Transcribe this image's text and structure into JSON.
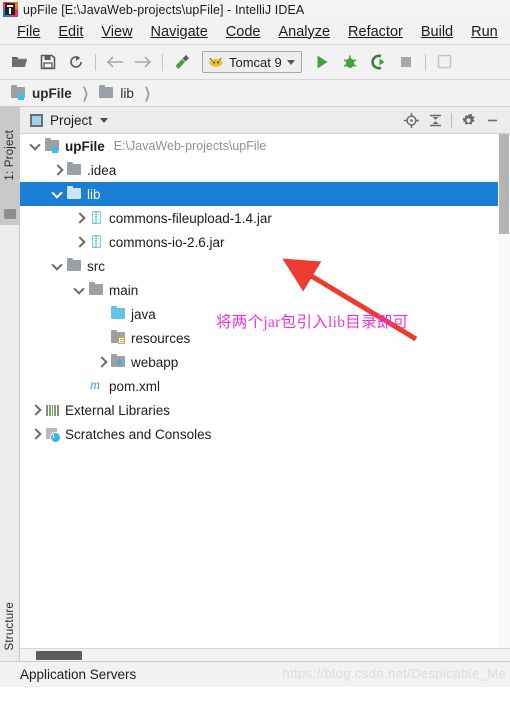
{
  "window": {
    "title": "upFile [E:\\JavaWeb-projects\\upFile] - IntelliJ IDEA",
    "app_icon": "intellij-idea-logo"
  },
  "menubar": {
    "items": [
      {
        "label": "File"
      },
      {
        "label": "Edit"
      },
      {
        "label": "View"
      },
      {
        "label": "Navigate"
      },
      {
        "label": "Code"
      },
      {
        "label": "Analyze"
      },
      {
        "label": "Refactor"
      },
      {
        "label": "Build"
      },
      {
        "label": "Run"
      }
    ]
  },
  "toolbar": {
    "buttons": [
      {
        "name": "open-icon",
        "label": "Open"
      },
      {
        "name": "save-icon",
        "label": "Save All"
      },
      {
        "name": "sync-icon",
        "label": "Synchronize"
      },
      {
        "name": "back-icon",
        "label": "Back"
      },
      {
        "name": "forward-icon",
        "label": "Forward"
      },
      {
        "name": "build-hammer-icon",
        "label": "Build Project"
      }
    ],
    "run_config": {
      "label": "Tomcat 9",
      "icon": "tomcat-cat-icon"
    },
    "run_buttons": [
      {
        "name": "run-icon",
        "label": "Run"
      },
      {
        "name": "debug-icon",
        "label": "Debug"
      },
      {
        "name": "run-with-coverage-icon",
        "label": "Run with Coverage"
      },
      {
        "name": "stop-icon",
        "label": "Stop"
      }
    ]
  },
  "breadcrumb": {
    "items": [
      {
        "label": "upFile",
        "icon": "module-folder-icon",
        "bold": true
      },
      {
        "label": "lib",
        "icon": "folder-icon",
        "bold": false
      }
    ]
  },
  "left_strip": {
    "tabs": [
      {
        "label": "1: Project",
        "active": true
      },
      {
        "label": "Structure",
        "active": false
      }
    ]
  },
  "panel": {
    "title": "Project",
    "buttons": [
      {
        "name": "locate-icon",
        "label": "Select Opened File"
      },
      {
        "name": "collapse-all-icon",
        "label": "Collapse All"
      },
      {
        "name": "gear-icon",
        "label": "Settings"
      },
      {
        "name": "minimize-icon",
        "label": "Hide"
      }
    ]
  },
  "tree": {
    "nodes": [
      {
        "label": "upFile",
        "sublabel": "E:\\JavaWeb-projects\\upFile",
        "indent": 0,
        "arrow": "down",
        "icon": "module-folder-icon",
        "bold": true,
        "selected": false
      },
      {
        "label": ".idea",
        "sublabel": "",
        "indent": 1,
        "arrow": "right",
        "icon": "folder-icon",
        "bold": false,
        "selected": false
      },
      {
        "label": "lib",
        "sublabel": "",
        "indent": 1,
        "arrow": "down",
        "icon": "folder-icon-light",
        "bold": false,
        "selected": true
      },
      {
        "label": "commons-fileupload-1.4.jar",
        "sublabel": "",
        "indent": 2,
        "arrow": "right",
        "icon": "jar-icon",
        "bold": false,
        "selected": false
      },
      {
        "label": "commons-io-2.6.jar",
        "sublabel": "",
        "indent": 2,
        "arrow": "right",
        "icon": "jar-icon",
        "bold": false,
        "selected": false
      },
      {
        "label": "src",
        "sublabel": "",
        "indent": 1,
        "arrow": "down",
        "icon": "folder-icon",
        "bold": false,
        "selected": false
      },
      {
        "label": "main",
        "sublabel": "",
        "indent": 2,
        "arrow": "down",
        "icon": "folder-icon",
        "bold": false,
        "selected": false
      },
      {
        "label": "java",
        "sublabel": "",
        "indent": 3,
        "arrow": "none",
        "icon": "source-folder-icon",
        "bold": false,
        "selected": false
      },
      {
        "label": "resources",
        "sublabel": "",
        "indent": 3,
        "arrow": "none",
        "icon": "resources-folder-icon",
        "bold": false,
        "selected": false
      },
      {
        "label": "webapp",
        "sublabel": "",
        "indent": 3,
        "arrow": "right",
        "icon": "webapp-folder-icon",
        "bold": false,
        "selected": false
      },
      {
        "label": "pom.xml",
        "sublabel": "",
        "indent": 2,
        "arrow": "none",
        "icon": "maven-icon",
        "bold": false,
        "selected": false
      },
      {
        "label": "External Libraries",
        "sublabel": "",
        "indent": 0,
        "arrow": "right",
        "icon": "libraries-icon",
        "bold": false,
        "selected": false
      },
      {
        "label": "Scratches and Consoles",
        "sublabel": "",
        "indent": 0,
        "arrow": "right",
        "icon": "scratches-icon",
        "bold": false,
        "selected": false
      }
    ]
  },
  "annotation": {
    "text": "将两个jar包引入lib目录即可",
    "color": "#f032d8",
    "arrow_color": "#ee3b2f"
  },
  "statusbar": {
    "label": "Application Servers"
  },
  "watermark": {
    "text": "https://blog.csdn.net/Despicable_Me"
  },
  "colors": {
    "selection_blue": "#1a7fd4",
    "toolbar_bg": "#f2f2f2",
    "panel_bg": "#ececec",
    "run_green": "#46a03c"
  }
}
